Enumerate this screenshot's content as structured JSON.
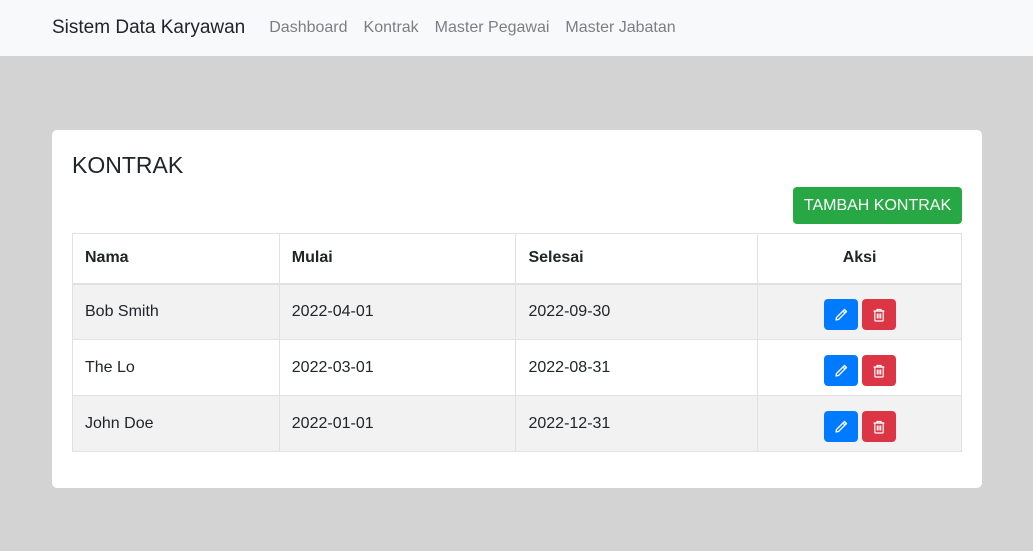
{
  "navbar": {
    "brand": "Sistem Data Karyawan",
    "links": [
      "Dashboard",
      "Kontrak",
      "Master Pegawai",
      "Master Jabatan"
    ]
  },
  "card": {
    "title": "KONTRAK",
    "add_button": "TAMBAH KONTRAK"
  },
  "table": {
    "headers": [
      "Nama",
      "Mulai",
      "Selesai",
      "Aksi"
    ],
    "rows": [
      {
        "nama": "Bob Smith",
        "mulai": "2022-04-01",
        "selesai": "2022-09-30"
      },
      {
        "nama": "The Lo",
        "mulai": "2022-03-01",
        "selesai": "2022-08-31"
      },
      {
        "nama": "John Doe",
        "mulai": "2022-01-01",
        "selesai": "2022-12-31"
      }
    ]
  },
  "colors": {
    "navbar_bg": "#f8f9fa",
    "page_bg": "#d3d3d3",
    "add_button": "#28a745",
    "edit_button": "#007bff",
    "delete_button": "#dc3545"
  },
  "icons": {
    "edit": "pencil-icon",
    "delete": "trash-icon"
  }
}
